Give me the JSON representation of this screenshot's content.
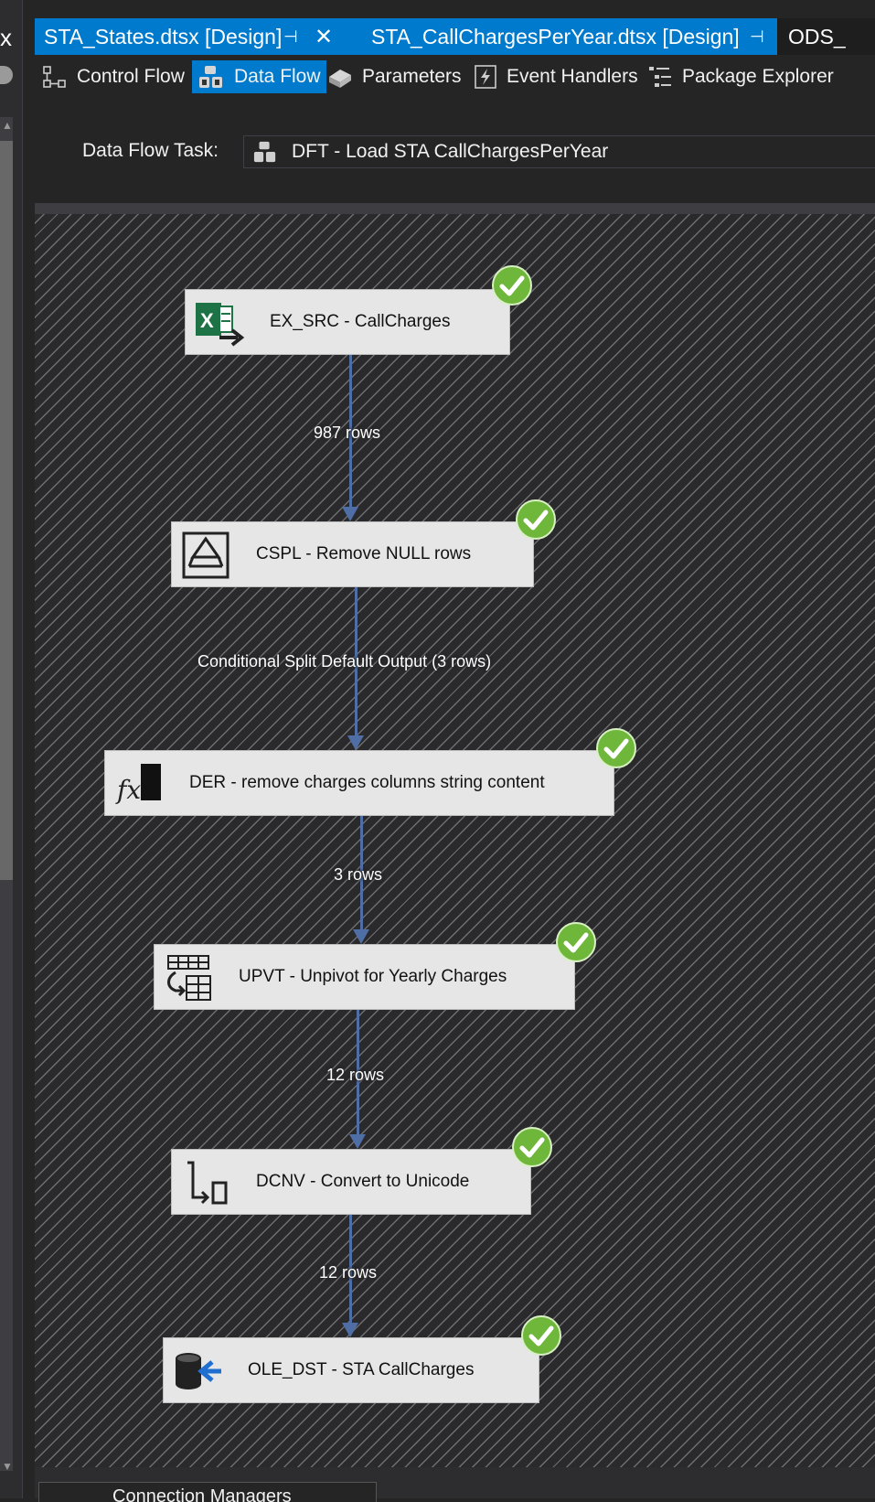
{
  "tabs": [
    {
      "label": "STA_States.dtsx [Design]"
    },
    {
      "label": "STA_CallChargesPerYear.dtsx [Design]"
    },
    {
      "label": "ODS_"
    }
  ],
  "left_strip": {
    "close_glyph": "x"
  },
  "designer_tabs": [
    {
      "label": "Control Flow",
      "icon": "control-flow-icon"
    },
    {
      "label": "Data Flow",
      "icon": "data-flow-icon",
      "active": true
    },
    {
      "label": "Parameters",
      "icon": "parameters-icon"
    },
    {
      "label": "Event Handlers",
      "icon": "event-handlers-icon"
    },
    {
      "label": "Package Explorer",
      "icon": "package-explorer-icon"
    }
  ],
  "task": {
    "label": "Data Flow Task:",
    "value": "DFT - Load STA CallChargesPerYear"
  },
  "components": [
    {
      "label": "EX_SRC - CallCharges",
      "icon": "excel-source-icon",
      "status": "success"
    },
    {
      "label": "CSPL - Remove NULL rows",
      "icon": "conditional-split-icon",
      "status": "success"
    },
    {
      "label": "DER - remove charges columns string content",
      "icon": "derived-column-icon",
      "status": "success"
    },
    {
      "label": "UPVT - Unpivot for Yearly Charges",
      "icon": "unpivot-icon",
      "status": "success"
    },
    {
      "label": "DCNV - Convert to Unicode",
      "icon": "data-conversion-icon",
      "status": "success"
    },
    {
      "label": "OLE_DST - STA CallCharges",
      "icon": "ole-db-destination-icon",
      "status": "success"
    }
  ],
  "paths": [
    {
      "label": "987 rows"
    },
    {
      "label": "Conditional Split Default Output (3 rows)"
    },
    {
      "label": "3 rows"
    },
    {
      "label": "12 rows"
    },
    {
      "label": "12 rows"
    }
  ],
  "bottom_panel": {
    "label": "Connection Managers"
  },
  "colors": {
    "accent": "#007acc",
    "canvas": "#2a2a2c",
    "path": "#4f6ea6",
    "success": "#6fb73a"
  }
}
